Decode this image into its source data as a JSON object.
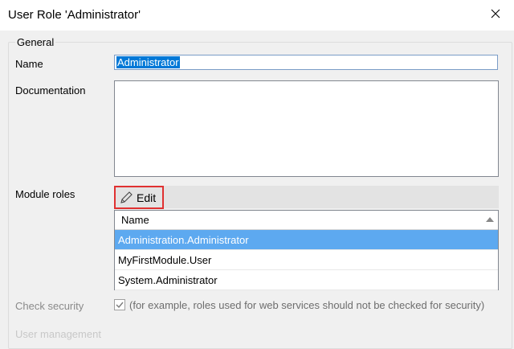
{
  "window": {
    "title": "User Role 'Administrator'"
  },
  "general": {
    "group_label": "General",
    "name_label": "Name",
    "name_value": "Administrator",
    "documentation_label": "Documentation",
    "documentation_value": "",
    "module_roles_label": "Module roles",
    "edit_label": "Edit",
    "grid_header": "Name",
    "module_roles": [
      {
        "name": "Administration.Administrator",
        "selected": true
      },
      {
        "name": "MyFirstModule.User",
        "selected": false
      },
      {
        "name": "System.Administrator",
        "selected": false
      }
    ],
    "check_security_label": "Check security",
    "check_security_checked": true,
    "check_security_hint": "(for example, roles used for web services should not be checked for security)"
  },
  "user_management": {
    "group_label": "User management"
  },
  "icons": {
    "close": "close-icon",
    "edit": "pencil-icon",
    "sort": "sort-ascending-icon",
    "check": "checkmark-icon"
  },
  "colors": {
    "selection": "#0078d7",
    "row_selected": "#5da9f0",
    "highlight_border": "#e03131"
  }
}
